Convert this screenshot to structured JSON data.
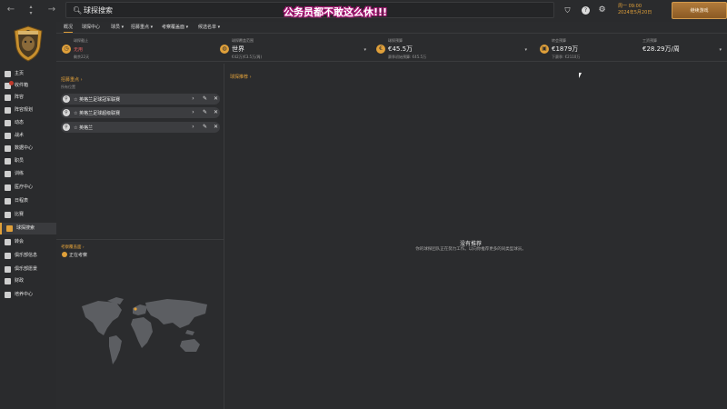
{
  "topbar": {
    "back_icon": "arrow-left-icon",
    "forward_icon": "arrow-right-icon",
    "search_icon": "search-icon",
    "search_text": "球探搜索",
    "overlay_text": "公务员都不敢这么休!!!",
    "date_line1": "周一 09:00",
    "date_line2": "2024年5月20日",
    "continue_label": "继续游戏"
  },
  "sidebar": {
    "items": [
      {
        "label": "主页",
        "icon": "home-icon"
      },
      {
        "label": "收件箱",
        "icon": "inbox-icon"
      },
      {
        "label": "阵容",
        "icon": "shirt-icon"
      },
      {
        "label": "阵容规划",
        "icon": "planner-icon"
      },
      {
        "label": "动态",
        "icon": "chat-icon"
      },
      {
        "label": "战术",
        "icon": "tactics-icon"
      },
      {
        "label": "数据中心",
        "icon": "data-icon"
      },
      {
        "label": "职员",
        "icon": "staff-icon"
      },
      {
        "label": "训练",
        "icon": "training-icon"
      },
      {
        "label": "医疗中心",
        "icon": "medical-icon"
      },
      {
        "label": "日程表",
        "icon": "calendar-icon"
      },
      {
        "label": "比赛",
        "icon": "trophy-icon"
      },
      {
        "label": "球探搜索",
        "icon": "scouting-icon"
      },
      {
        "label": "转会",
        "icon": "transfer-icon"
      },
      {
        "label": "俱乐部信息",
        "icon": "club-info-icon"
      },
      {
        "label": "俱乐部愿景",
        "icon": "vision-icon"
      },
      {
        "label": "财政",
        "icon": "finance-icon"
      },
      {
        "label": "培养中心",
        "icon": "development-icon"
      }
    ]
  },
  "tabs": [
    {
      "label": "概况"
    },
    {
      "label": "球探中心"
    },
    {
      "label": "球员 ▾"
    },
    {
      "label": "招募重点 ▾"
    },
    {
      "label": "考察覆盖面 ▾"
    },
    {
      "label": "候选名单 ▾"
    }
  ],
  "stats": [
    {
      "label": "球探截止",
      "value": "无用",
      "sub": "剩余22天"
    },
    {
      "label": "球探覆盖范围",
      "value": "世界",
      "sub": "€42万(€3.5万/周)"
    },
    {
      "label": "球探预算",
      "value": "€45.5万",
      "sub": "赛季初始预算: €45.5万"
    },
    {
      "label": "转会预算",
      "value": "€1879万",
      "sub": "下赛季: €2110万"
    },
    {
      "label": "工资预算",
      "value": "€28.29万/周",
      "sub": ""
    }
  ],
  "left": {
    "focus_title": "招募重点 ›",
    "all_positions": "所有位置",
    "regions": [
      {
        "label": "☆ 英格兰足球冠军联赛"
      },
      {
        "label": "☆ 英格兰足球超级联赛"
      },
      {
        "label": "☆ 英格兰"
      }
    ],
    "coverage_title": "考察覆盖面 ›",
    "coverage_status": "正在考察"
  },
  "right": {
    "title": "球探推荐 ›",
    "no_rec_title": "没有推荐",
    "no_rec_sub": "你的球探团队正在努力工作。以向你推荐更多的同类型球员。"
  },
  "colors": {
    "accent": "#e0a03a",
    "bg": "#2b2c2e"
  }
}
